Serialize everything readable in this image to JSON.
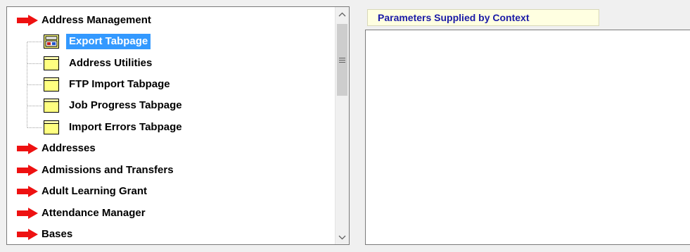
{
  "tree": {
    "items": [
      {
        "label": "Address Management",
        "icon": "red-arrow-icon"
      },
      {
        "label": "Export Tabpage",
        "icon": "export-form-icon",
        "selected": true
      },
      {
        "label": "Address Utilities",
        "icon": "folder-icon"
      },
      {
        "label": "FTP Import Tabpage",
        "icon": "folder-icon"
      },
      {
        "label": "Job Progress Tabpage",
        "icon": "folder-icon"
      },
      {
        "label": "Import Errors Tabpage",
        "icon": "folder-icon"
      },
      {
        "label": "Addresses",
        "icon": "red-arrow-icon"
      },
      {
        "label": "Admissions and Transfers",
        "icon": "red-arrow-icon"
      },
      {
        "label": "Adult Learning Grant",
        "icon": "red-arrow-icon"
      },
      {
        "label": "Attendance Manager",
        "icon": "red-arrow-icon"
      },
      {
        "label": "Bases",
        "icon": "red-arrow-icon"
      }
    ]
  },
  "context": {
    "tab_label": "Parameters Supplied by Context"
  },
  "colors": {
    "arrow": "#ee1111",
    "selection": "#3399ff",
    "folder": "#ffff80",
    "context_tab_text": "#1a1aa6"
  }
}
